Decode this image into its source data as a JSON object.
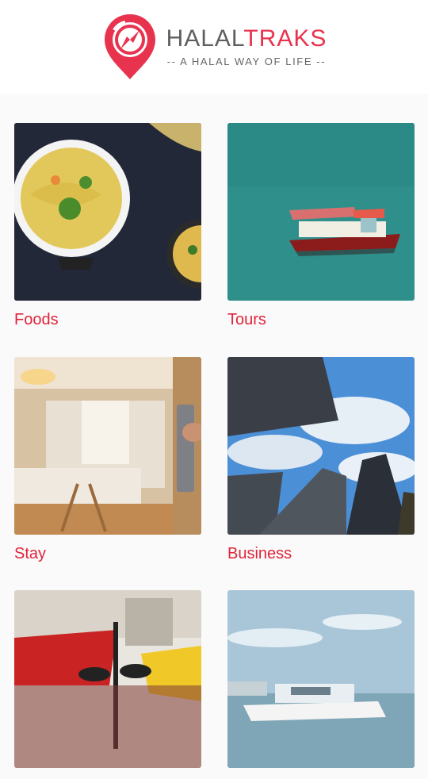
{
  "header": {
    "brand_part1": "HALAL",
    "brand_part2": "TRAKS",
    "tagline": "-- A HALAL WAY OF LIFE --"
  },
  "colors": {
    "brand_red": "#e8334f",
    "label_red": "#e0243b",
    "brand_gray": "#5f5f5f"
  },
  "categories": [
    {
      "label": "Foods",
      "icon": "noodle-soup-photo"
    },
    {
      "label": "Tours",
      "icon": "boat-on-sea-photo"
    },
    {
      "label": "Stay",
      "icon": "hotel-room-photo"
    },
    {
      "label": "Business",
      "icon": "skyscrapers-photo"
    },
    {
      "label": "",
      "icon": "street-cafe-umbrellas-photo"
    },
    {
      "label": "",
      "icon": "yacht-harbor-photo"
    }
  ]
}
